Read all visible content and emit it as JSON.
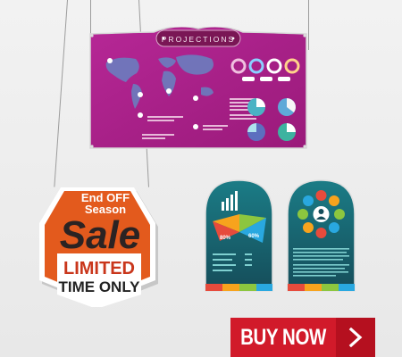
{
  "projection_sign": {
    "title": "PROJECTIONS"
  },
  "sale_badge": {
    "top_line": "End OFF",
    "sub_line": "Season",
    "headline": "Sale",
    "offer_line1": "LIMITED",
    "offer_line2": "TIME ONLY"
  },
  "chart_board": {
    "values": [
      "80%",
      "60%"
    ]
  },
  "buy_button": {
    "label": "BUY NOW",
    "icon": "chevron-right-icon"
  },
  "colors": {
    "sign": "#b3208c",
    "sign_header": "#7a1655",
    "badge_orange": "#e35a1d",
    "board_teal": "#1b6d74",
    "button_red": "#d11a2a"
  }
}
